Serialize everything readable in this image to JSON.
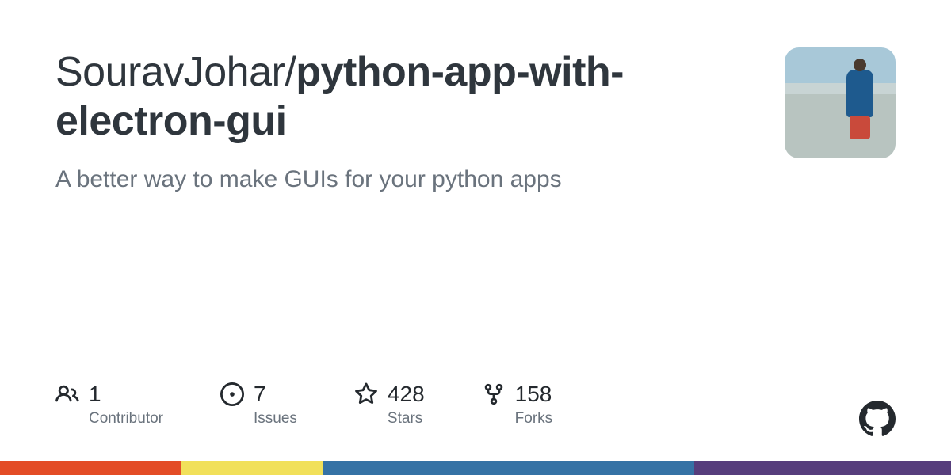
{
  "repo": {
    "owner": "SouravJohar",
    "slash": "/",
    "name": "python-app-with-electron-gui",
    "description": "A better way to make GUIs for your python apps"
  },
  "stats": {
    "contributors": {
      "count": "1",
      "label": "Contributor"
    },
    "issues": {
      "count": "7",
      "label": "Issues"
    },
    "stars": {
      "count": "428",
      "label": "Stars"
    },
    "forks": {
      "count": "158",
      "label": "Forks"
    }
  },
  "lang_bar": [
    {
      "color": "#e34c26",
      "pct": 19
    },
    {
      "color": "#f1e05a",
      "pct": 15
    },
    {
      "color": "#3572A5",
      "pct": 39
    },
    {
      "color": "#563d7c",
      "pct": 27
    }
  ]
}
